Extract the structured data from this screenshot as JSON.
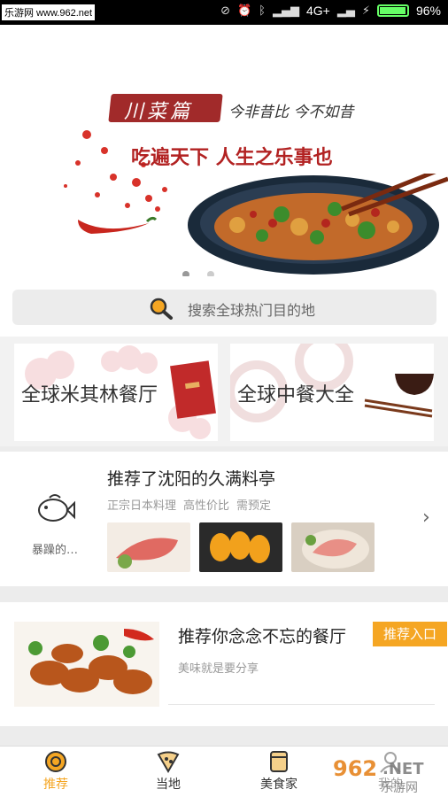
{
  "status_bar": {
    "watermark": "乐游网 www.962.net",
    "network": "4G+",
    "battery": "96%"
  },
  "banner": {
    "title": "川菜篇",
    "subtitle": "今非昔比 今不如昔",
    "slogan": "吃遍天下 人生之乐事也"
  },
  "search": {
    "placeholder": "搜索全球热门目的地"
  },
  "cards": [
    {
      "label": "全球米其林餐厅"
    },
    {
      "label": "全球中餐大全"
    }
  ],
  "recommendation": {
    "user": "暴躁的…",
    "title": "推荐了沈阳的久满料亭",
    "tags": [
      "正宗日本料理",
      "高性价比",
      "需预定"
    ]
  },
  "restaurant_promo": {
    "title": "推荐你念念不忘的餐厅",
    "subtitle": "美味就是要分享",
    "badge": "推荐入口"
  },
  "tabs": [
    {
      "label": "推荐",
      "icon": "recommend-icon",
      "active": true
    },
    {
      "label": "当地",
      "icon": "local-icon",
      "active": false
    },
    {
      "label": "美食家",
      "icon": "gourmet-icon",
      "active": false
    },
    {
      "label": "我的",
      "icon": "profile-icon",
      "active": false
    }
  ],
  "colors": {
    "accent": "#f5a623",
    "banner_red": "#b22222"
  },
  "logo_text": "962.NET 乐游网"
}
